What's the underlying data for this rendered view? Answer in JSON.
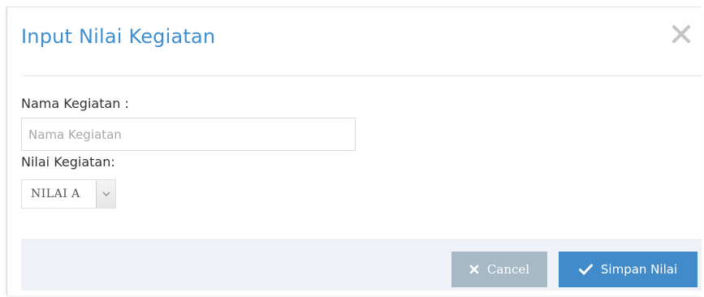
{
  "modal": {
    "title": "Input Nilai Kegiatan"
  },
  "form": {
    "name_label": "Nama Kegiatan :",
    "name_placeholder": "Nama Kegiatan",
    "name_value": "",
    "value_label": "Nilai Kegiatan:",
    "value_selected": "NILAI A"
  },
  "footer": {
    "cancel_label": "Cancel",
    "save_label": "Simpan Nilai"
  },
  "icons": {
    "close": "close-icon",
    "cancel": "times-icon",
    "save": "check-icon",
    "dropdown": "chevron-down-icon"
  },
  "colors": {
    "title": "#3f8fd0",
    "save_button": "#428bca",
    "cancel_button": "#a8b9c6",
    "footer_bg": "#eff3f8"
  }
}
